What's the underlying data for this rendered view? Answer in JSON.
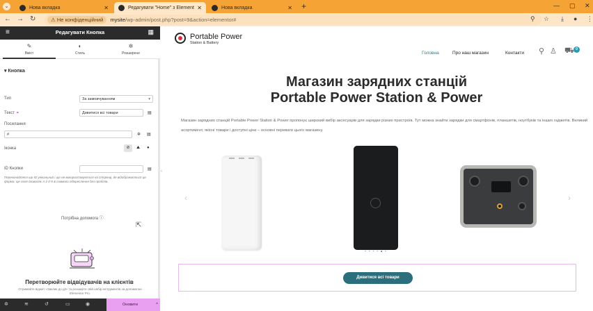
{
  "browser": {
    "tabs": [
      {
        "title": "Нова вкладка",
        "active": false
      },
      {
        "title": "Редагувати \"Home\" з Elementor",
        "active": true
      },
      {
        "title": "Нова вкладка",
        "active": false
      }
    ],
    "secure_label": "Не конфіденційний",
    "url_host": "mysite",
    "url_path": "/wp-admin/post.php?post=9&action=elementor#",
    "accent_color": "#f6a336"
  },
  "panel": {
    "title": "Редагувати Кнопка",
    "tabs": [
      {
        "label": "Вміст",
        "icon": "pencil-icon"
      },
      {
        "label": "Стиль",
        "icon": "contrast-icon"
      },
      {
        "label": "Розширене",
        "icon": "gear-icon"
      }
    ],
    "section": "Кнопка",
    "fields": {
      "type_label": "Тип",
      "type_value": "За замовчуванням",
      "text_label": "Текст",
      "text_value": "Дивитися всі товари",
      "link_label": "Посилання",
      "link_value": "#",
      "icon_label": "Іконка",
      "id_label": "ID Кнопки",
      "id_value": ""
    },
    "hint": "Переконайтеся що ID унікальний і що не використовується на сторінці, де відображається ця форма. Це поле дозволяє A-z 0-9 & символи підкреслення без пробілів.",
    "help_label": "Потрібна допомога",
    "promo_title": "Перетворюйте відвідувачів на клієнтів",
    "promo_text": "Отримайте віджет «Заклик до дії» та розширте свій набір інструментів за допомогою Elementor Pro.",
    "publish_label": "Оновити",
    "publish_color": "#e9a0f0"
  },
  "site": {
    "logo_name": "Portable Power",
    "logo_sub": "Station & Battery",
    "nav": [
      "Головна",
      "Про наш магазин",
      "Контакти"
    ],
    "cart_count": "0",
    "hero_title_line1": "Магазин зарядних станцій",
    "hero_title_line2": "Portable Power Station & Power",
    "hero_desc": "Магазин зарядних станцій Portable Power Station & Power пропонує широкий вибір аксесуарів для зарядки різних пристроїв. Тут можна знайти зарядки для смартфонів, планшетів, ноутбуків та інших гаджетів. Великий асортимент, якісні товари і доступні ціни – основні переваги цього магазину.",
    "slider_pages": 6,
    "slider_active": 5,
    "cta_label": "Дивитися всі товари",
    "cta_color": "#2c6f7c"
  }
}
